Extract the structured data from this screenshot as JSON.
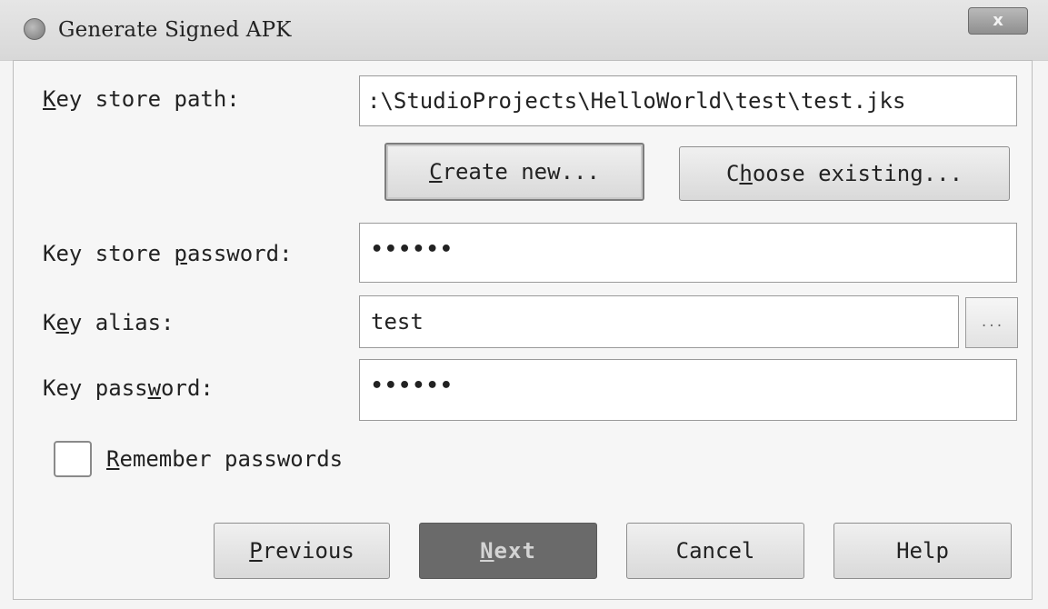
{
  "window": {
    "title": "Generate Signed APK",
    "close_label": "x"
  },
  "keystore": {
    "path_label_u": "K",
    "path_label_rest": "ey store path:",
    "path_value": ":\\StudioProjects\\HelloWorld\\test\\test.jks",
    "create_u": "C",
    "create_rest": "reate new...",
    "choose_pre": "C",
    "choose_u": "h",
    "choose_rest": "oose existing...",
    "password_label_pre": "Key store ",
    "password_label_u": "p",
    "password_label_rest": "assword:",
    "password_value": "••••••"
  },
  "key": {
    "alias_label_pre": "K",
    "alias_label_u": "e",
    "alias_label_rest": "y alias:",
    "alias_value": "test",
    "alias_browse_label": "...",
    "password_label_pre": "Key pass",
    "password_label_u": "w",
    "password_label_rest": "ord:",
    "password_value": "••••••"
  },
  "remember": {
    "label_u": "R",
    "label_rest": "emember passwords"
  },
  "footer": {
    "previous_u": "P",
    "previous_rest": "revious",
    "next_u": "N",
    "next_rest": "ext",
    "cancel_label": "Cancel",
    "help_label": "Help"
  }
}
